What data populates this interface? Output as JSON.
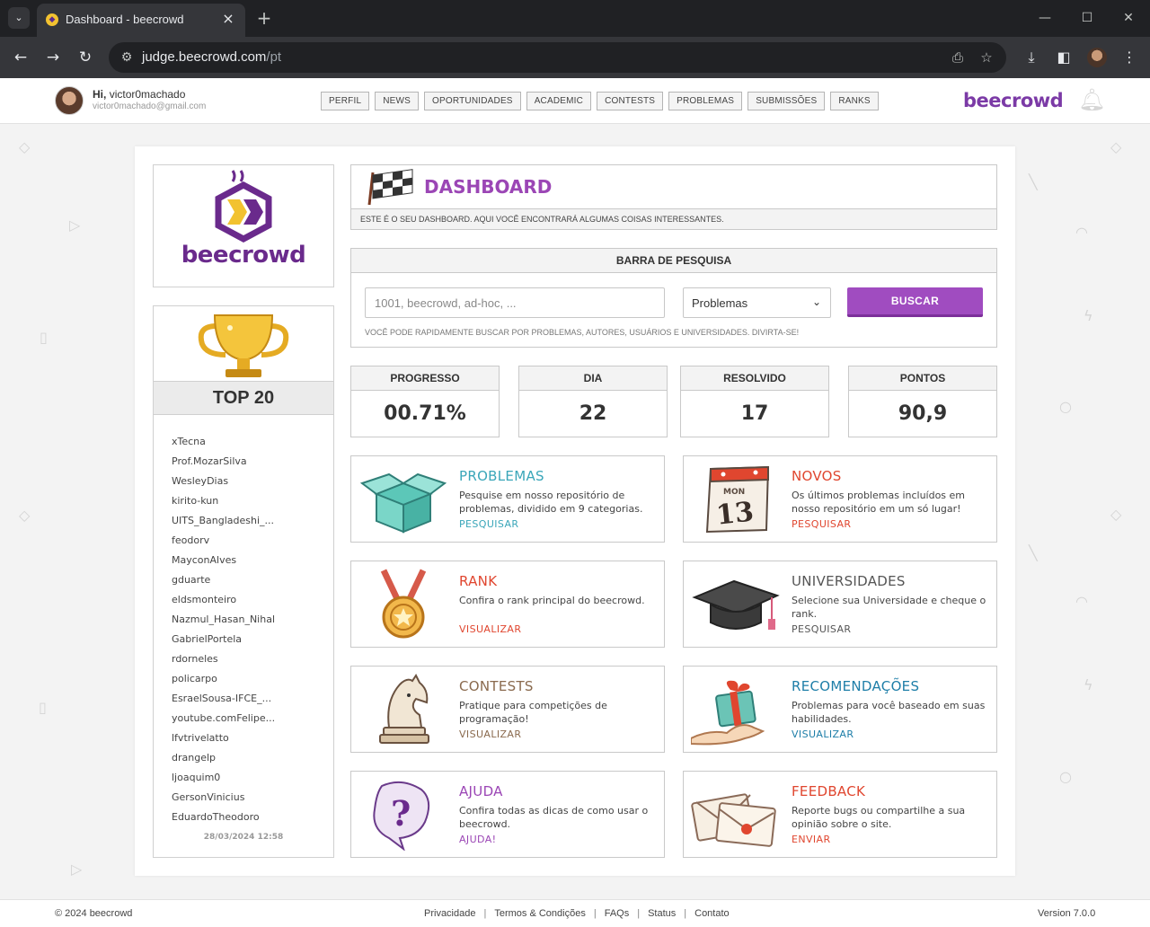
{
  "browser": {
    "tab_title": "Dashboard - beecrowd",
    "url_host": "judge.beecrowd.com",
    "url_path": "/pt"
  },
  "header": {
    "greeting": "Hi,",
    "username": "victor0machado",
    "email": "victor0machado@gmail.com",
    "nav": [
      "PERFIL",
      "NEWS",
      "OPORTUNIDADES",
      "ACADEMIC",
      "CONTESTS",
      "PROBLEMAS",
      "SUBMISSÕES",
      "RANKS"
    ],
    "brand": "beecrowd"
  },
  "logo": {
    "text": "beecrowd"
  },
  "top20": {
    "title": "TOP 20",
    "users": [
      "xTecna",
      "Prof.MozarSilva",
      "WesleyDias",
      "kirito-kun",
      "UITS_Bangladeshi_...",
      "feodorv",
      "MayconAlves",
      "gduarte",
      "eldsmonteiro",
      "Nazmul_Hasan_Nihal",
      "GabrielPortela",
      "rdorneles",
      "policarpo",
      "EsraelSousa-IFCE_...",
      "youtube.comFelipe...",
      "lfvtrivelatto",
      "drangelp",
      "ljoaquim0",
      "GersonVinicius",
      "EduardoTheodoro"
    ],
    "updated": "28/03/2024 12:58"
  },
  "dashboard": {
    "title": "DASHBOARD",
    "subtitle": "ESTE É O SEU DASHBOARD. AQUI VOCÊ ENCONTRARÁ ALGUMAS COISAS INTERESSANTES."
  },
  "search": {
    "title": "BARRA DE PESQUISA",
    "placeholder": "1001, beecrowd, ad-hoc, ...",
    "select_value": "Problemas",
    "button": "BUSCAR",
    "hint": "VOCÊ PODE RAPIDAMENTE BUSCAR POR PROBLEMAS, AUTORES, USUÁRIOS E UNIVERSIDADES. DIVIRTA-SE!"
  },
  "stats": [
    {
      "label": "PROGRESSO",
      "value": "00.71%"
    },
    {
      "label": "DIA",
      "value": "22"
    },
    {
      "label": "RESOLVIDO",
      "value": "17"
    },
    {
      "label": "PONTOS",
      "value": "90,9"
    }
  ],
  "features": [
    {
      "title": "PROBLEMAS",
      "desc": "Pesquise em nosso repositório de problemas, dividido em 9 categorias.",
      "link": "PESQUISAR",
      "color": "#3aa6b9",
      "icon": "box-icon"
    },
    {
      "title": "NOVOS",
      "desc": "Os últimos problemas incluídos em nosso repositório em um só lugar!",
      "link": "PESQUISAR",
      "color": "#e0462f",
      "icon": "calendar-icon",
      "badge_day": "MON",
      "badge_num": "13"
    },
    {
      "title": "RANK",
      "desc": "Confira o rank principal do beecrowd.",
      "link": "VISUALIZAR",
      "color": "#e0462f",
      "icon": "medal-icon"
    },
    {
      "title": "UNIVERSIDADES",
      "desc": "Selecione sua Universidade e cheque o rank.",
      "link": "PESQUISAR",
      "color": "#555555",
      "icon": "graduation-cap-icon"
    },
    {
      "title": "CONTESTS",
      "desc": "Pratique para competições de programação!",
      "link": "VISUALIZAR",
      "color": "#8a6a4e",
      "icon": "chess-knight-icon"
    },
    {
      "title": "RECOMENDAÇÕES",
      "desc": "Problemas para você baseado em suas habilidades.",
      "link": "VISUALIZAR",
      "color": "#1e7ea8",
      "icon": "gift-icon"
    },
    {
      "title": "AJUDA",
      "desc": "Confira todas as dicas de como usar o beecrowd.",
      "link": "AJUDA!",
      "color": "#9b46b5",
      "icon": "question-bubble-icon"
    },
    {
      "title": "FEEDBACK",
      "desc": "Reporte bugs ou compartilhe a sua opinião sobre o site.",
      "link": "ENVIAR",
      "color": "#e0462f",
      "icon": "envelope-icon"
    }
  ],
  "footer": {
    "copyright": "© 2024 beecrowd",
    "links": [
      "Privacidade",
      "Termos & Condições",
      "FAQs",
      "Status",
      "Contato"
    ],
    "version": "Version 7.0.0"
  }
}
